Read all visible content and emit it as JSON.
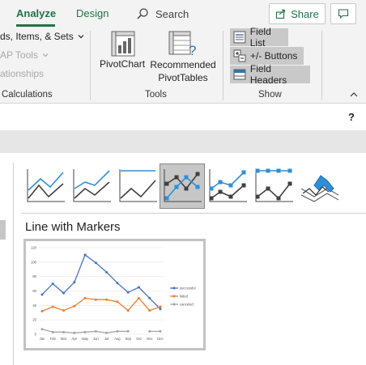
{
  "ribbon": {
    "tabs": [
      {
        "label": "Analyze",
        "active": true
      },
      {
        "label": "Design",
        "active": false
      }
    ],
    "search_label": "Search",
    "share_label": "Share",
    "accent": "#217346",
    "active_group": {
      "items": [
        {
          "label": "ds, Items, & Sets",
          "enabled": true,
          "dropdown": true
        },
        {
          "label": "AP Tools",
          "enabled": false,
          "dropdown": true
        },
        {
          "label": "ationships",
          "enabled": false
        }
      ],
      "group_label": "Calculations"
    },
    "tools_group": {
      "buttons": [
        {
          "label": "PivotChart"
        },
        {
          "label": "Recommended PivotTables"
        }
      ],
      "group_label": "Tools"
    },
    "show_group": {
      "buttons": [
        {
          "label": "Field List"
        },
        {
          "label": "+/- Buttons"
        },
        {
          "label": "Field Headers"
        }
      ],
      "group_label": "Show"
    }
  },
  "dialog": {
    "help_label": "?",
    "chart_types": [
      {
        "icon": "line-chart-icon",
        "selected": false
      },
      {
        "icon": "stacked-line-chart-icon",
        "selected": false
      },
      {
        "icon": "100-stacked-line-chart-icon",
        "selected": false
      },
      {
        "icon": "line-with-markers-chart-icon",
        "selected": true
      },
      {
        "icon": "stacked-line-with-markers-chart-icon",
        "selected": false
      },
      {
        "icon": "100-stacked-line-with-markers-chart-icon",
        "selected": false
      },
      {
        "icon": "3d-line-chart-icon",
        "selected": false
      }
    ],
    "selected_type_title": "Line with Markers",
    "preview_chart": {
      "chart_data": {
        "type": "line",
        "categories": [
          "Jan",
          "Feb",
          "Mar",
          "Apr",
          "May",
          "Jun",
          "Jul",
          "Aug",
          "Sep",
          "Oct",
          "Nov",
          "Dec"
        ],
        "series": [
          {
            "name": "successful",
            "color": "#4472c4",
            "values": [
              55,
              70,
              57,
              72,
              110,
              99,
              86,
              71,
              58,
              65,
              50,
              35
            ]
          },
          {
            "name": "failed",
            "color": "#ed7d31",
            "values": [
              32,
              38,
              33,
              39,
              50,
              48,
              48,
              45,
              33,
              50,
              33,
              38
            ]
          },
          {
            "name": "canceled",
            "color": "#a5a5a5",
            "values": [
              7,
              3,
              3,
              2,
              3,
              4,
              2,
              4,
              4,
              null,
              4,
              4
            ]
          }
        ],
        "yticks": [
          "0",
          "20",
          "40",
          "60",
          "80",
          "100",
          "120"
        ],
        "ylim": [
          0,
          120
        ],
        "legend": "right"
      }
    }
  }
}
